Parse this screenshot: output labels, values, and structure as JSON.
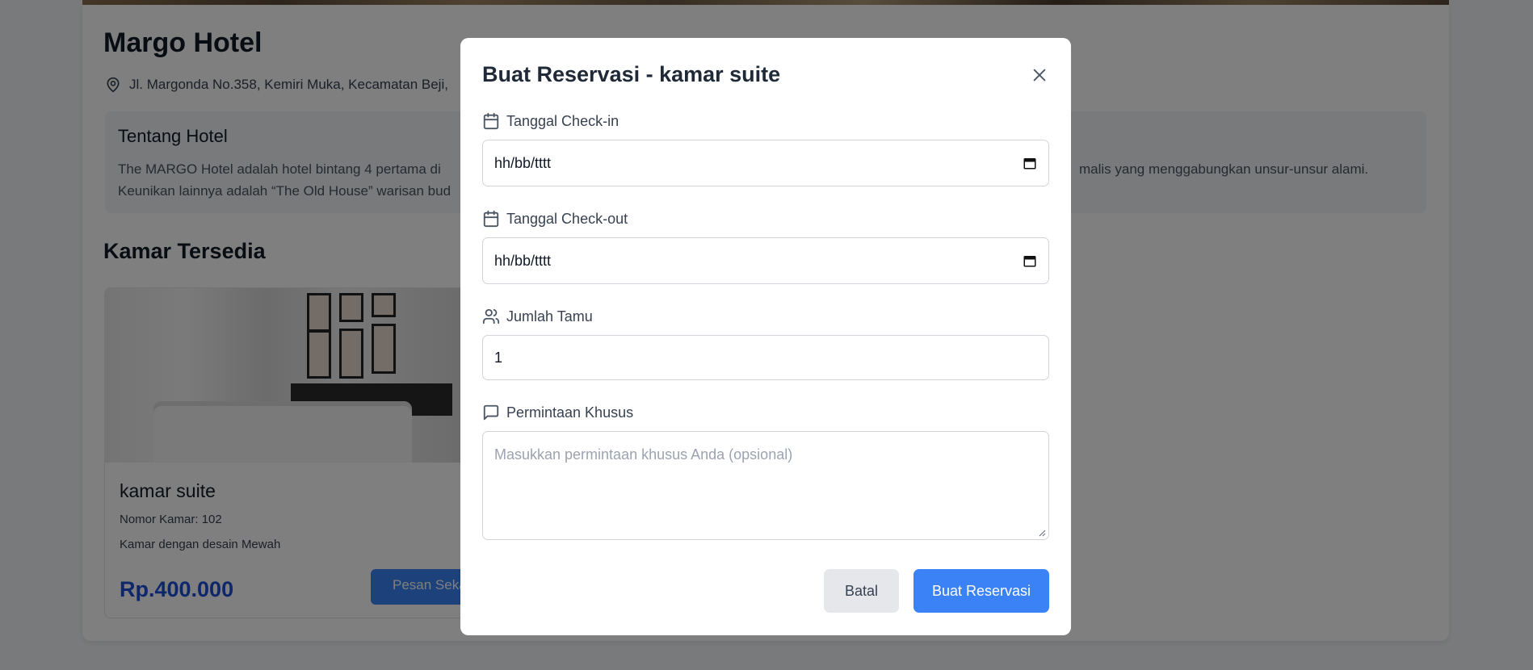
{
  "hotel": {
    "name": "Margo Hotel",
    "address": "Jl. Margonda No.358, Kemiri Muka, Kecamatan Beji,",
    "about_title": "Tentang Hotel",
    "about_line1_left": "The MARGO Hotel adalah hotel bintang 4 pertama di",
    "about_line1_right": "malis yang menggabungkan unsur-unsur alami.",
    "about_line2_left": "Keunikan lainnya adalah “The Old House” warisan bud"
  },
  "rooms_section": {
    "title": "Kamar Tersedia",
    "room": {
      "name": "kamar suite",
      "number_text": "Nomor Kamar: 102",
      "description": "Kamar dengan desain Mewah",
      "price": "Rp.400.000",
      "book_button": "Pesan Seka"
    }
  },
  "modal": {
    "title": "Buat Reservasi - kamar suite",
    "checkin": {
      "label": "Tanggal Check-in",
      "value": "hh/bb/tttt"
    },
    "checkout": {
      "label": "Tanggal Check-out",
      "value": "hh/bb/tttt"
    },
    "guests": {
      "label": "Jumlah Tamu",
      "value": "1"
    },
    "special": {
      "label": "Permintaan Khusus",
      "placeholder": "Masukkan permintaan khusus Anda (opsional)"
    },
    "cancel_label": "Batal",
    "submit_label": "Buat Reservasi"
  },
  "colors": {
    "primary": "#3b82f6",
    "price": "#1d4ed8",
    "overlay": "rgba(0,0,0,0.5)"
  },
  "icons": [
    "map-pin-icon",
    "calendar-icon",
    "users-icon",
    "message-square-icon",
    "close-icon"
  ]
}
